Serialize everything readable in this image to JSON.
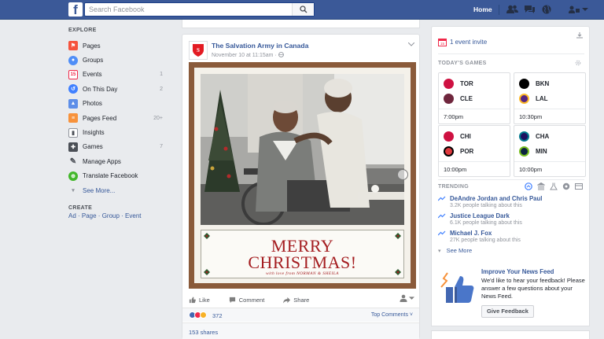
{
  "topbar": {
    "logo": "f",
    "search_placeholder": "Search Facebook",
    "home_label": "Home",
    "icons": [
      "friends-icon",
      "messages-icon",
      "globe-icon",
      "lock-icon",
      "dropdown-icon"
    ]
  },
  "leftnav": {
    "explore_heading": "EXPLORE",
    "items": [
      {
        "label": "Pages",
        "icon": "pages-flag-icon",
        "count": ""
      },
      {
        "label": "Groups",
        "icon": "groups-icon",
        "count": ""
      },
      {
        "label": "Events",
        "icon": "events-calendar-icon",
        "count": "1"
      },
      {
        "label": "On This Day",
        "icon": "on-this-day-icon",
        "count": "2"
      },
      {
        "label": "Photos",
        "icon": "photos-icon",
        "count": ""
      },
      {
        "label": "Pages Feed",
        "icon": "pages-feed-icon",
        "count": "20+"
      },
      {
        "label": "Insights",
        "icon": "insights-icon",
        "count": ""
      },
      {
        "label": "Games",
        "icon": "games-icon",
        "count": "7"
      },
      {
        "label": "Manage Apps",
        "icon": "manage-apps-icon",
        "count": ""
      },
      {
        "label": "Translate Facebook",
        "icon": "translate-icon",
        "count": ""
      }
    ],
    "see_more": "See More...",
    "create_heading": "CREATE",
    "create_links": "Ad · Page · Group · Event"
  },
  "post": {
    "page_name": "The Salvation Army in Canada",
    "time": "November 10 at 11:15am ·",
    "card_line1": "MERRY",
    "card_line2": "CHRISTMAS!",
    "card_love": "with love from NORMAN & SHEILA",
    "like_label": "Like",
    "comment_label": "Comment",
    "share_label": "Share",
    "reaction_count": "372",
    "top_comments": "Top Comments ˅",
    "shares": "153 shares"
  },
  "rightcol": {
    "event_invite": "1 event invite",
    "games_heading": "TODAY'S GAMES",
    "games": [
      {
        "team1": "TOR",
        "team2": "CLE",
        "time": "7:00pm",
        "c1": "#ce1141",
        "c2": "#6f263d"
      },
      {
        "team1": "BKN",
        "team2": "LAL",
        "time": "10:30pm",
        "c1": "#000000",
        "c2": "#552583"
      },
      {
        "team1": "CHI",
        "team2": "POR",
        "time": "10:00pm",
        "c1": "#ce1141",
        "c2": "#e03a3e"
      },
      {
        "team1": "CHA",
        "team2": "MIN",
        "time": "10:00pm",
        "c1": "#1d1160",
        "c2": "#0c2340"
      }
    ],
    "trending_heading": "TRENDING",
    "trends": [
      {
        "name": "DeAndre Jordan and Chris Paul",
        "sub": "3.2K people talking about this"
      },
      {
        "name": "Justice League Dark",
        "sub": "6.1K people talking about this"
      },
      {
        "name": "Michael J. Fox",
        "sub": "27K people talking about this"
      }
    ],
    "trend_see_more": "See More",
    "feedback_title": "Improve Your News Feed",
    "feedback_text": "We'd like to hear your feedback! Please answer a few questions about your News Feed.",
    "feedback_button": "Give Feedback"
  },
  "colors": {
    "brand": "#3b5998",
    "link": "#365899",
    "card_red": "#a41d20"
  }
}
